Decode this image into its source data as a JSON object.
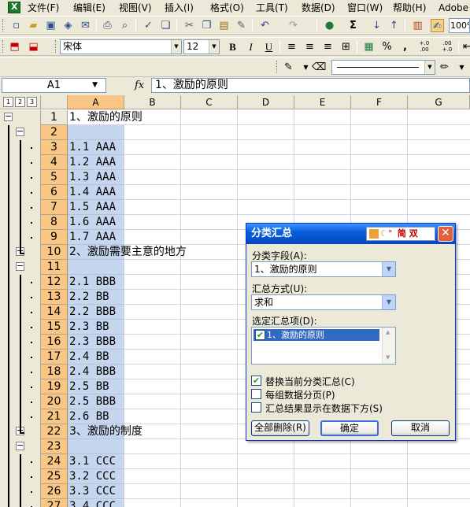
{
  "menu": {
    "items": [
      "文件(F)",
      "编辑(E)",
      "视图(V)",
      "插入(I)",
      "格式(O)",
      "工具(T)",
      "数据(D)",
      "窗口(W)",
      "帮助(H)",
      "Adobe P"
    ]
  },
  "toolbar": {
    "font_name": "宋体",
    "font_size": "12",
    "zoom": "100%",
    "bold_label": "B",
    "italic_label": "I",
    "underline_label": "U",
    "percent_label": "%",
    "comma_label": ",",
    "inc_decimal_label": "+.0 .00",
    "dec_decimal_label": ".00 +.0",
    "sigma_label": "Σ"
  },
  "formula_bar": {
    "name_box": "A1",
    "fx_label": "fx",
    "content": "1、激励的原则"
  },
  "grid": {
    "level_buttons": [
      "1",
      "2",
      "3"
    ],
    "columns": [
      "A",
      "B",
      "C",
      "D",
      "E",
      "F",
      "G"
    ],
    "rows": [
      {
        "num": "1",
        "text": "1、激励的原则",
        "cjk": true
      },
      {
        "num": "2",
        "text": ""
      },
      {
        "num": "3",
        "text": "1.1 AAA"
      },
      {
        "num": "4",
        "text": "1.2 AAA"
      },
      {
        "num": "5",
        "text": "1.3 AAA"
      },
      {
        "num": "6",
        "text": "1.4 AAA"
      },
      {
        "num": "7",
        "text": "1.5 AAA"
      },
      {
        "num": "8",
        "text": "1.6 AAA"
      },
      {
        "num": "9",
        "text": "1.7 AAA"
      },
      {
        "num": "10",
        "text": "2、激励需要主意的地方",
        "cjk": true
      },
      {
        "num": "11",
        "text": ""
      },
      {
        "num": "12",
        "text": "2.1 BBB"
      },
      {
        "num": "13",
        "text": "2.2 BB"
      },
      {
        "num": "14",
        "text": "2.2 BBB"
      },
      {
        "num": "15",
        "text": "2.3 BB"
      },
      {
        "num": "16",
        "text": "2.3 BBB"
      },
      {
        "num": "17",
        "text": "2.4 BB"
      },
      {
        "num": "18",
        "text": "2.4 BBB"
      },
      {
        "num": "19",
        "text": "2.5 BB"
      },
      {
        "num": "20",
        "text": "2.5 BBB"
      },
      {
        "num": "21",
        "text": "2.6 BB"
      },
      {
        "num": "22",
        "text": "3、激励的制度",
        "cjk": true
      },
      {
        "num": "23",
        "text": ""
      },
      {
        "num": "24",
        "text": "3.1 CCC"
      },
      {
        "num": "25",
        "text": "3.2 CCC"
      },
      {
        "num": "26",
        "text": "3.3 CCC"
      },
      {
        "num": "27",
        "text": "3.4 CCC"
      }
    ]
  },
  "dialog": {
    "title": "分类汇总",
    "ime_text": "简 双",
    "close_label": "✕",
    "group_field_label": "分类字段(A):",
    "group_field_value": "1、激励的原则",
    "function_label": "汇总方式(U):",
    "function_value": "求和",
    "items_label": "选定汇总项(D):",
    "items": [
      "1、激励的原则"
    ],
    "options": [
      {
        "label": "替换当前分类汇总(C)",
        "checked": true
      },
      {
        "label": "每组数据分页(P)",
        "checked": false
      },
      {
        "label": "汇总结果显示在数据下方(S)",
        "checked": false
      }
    ],
    "buttons": {
      "remove_all": "全部删除(R)",
      "ok": "确定",
      "cancel": "取消"
    }
  }
}
